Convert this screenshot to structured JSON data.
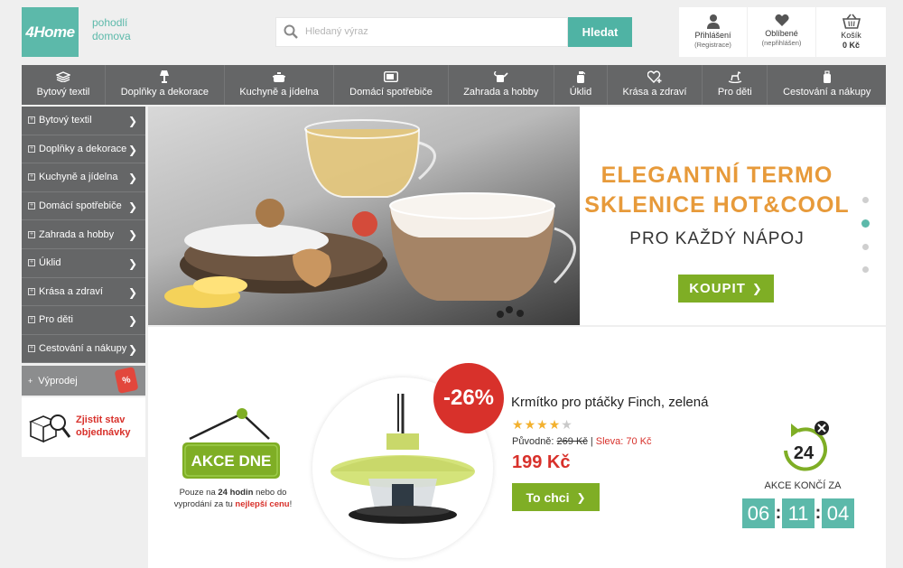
{
  "header": {
    "logo": "4Home",
    "tagline_line1": "pohodlí",
    "tagline_line2": "domova",
    "search_placeholder": "Hledaný výraz",
    "search_button": "Hledat",
    "login_label": "Přihlášení",
    "register_label": "(Registrace)",
    "favorites_label": "Oblíbené",
    "favorites_status": "(nepřihlášen)",
    "cart_label": "Košík",
    "cart_total": "0 Kč"
  },
  "topnav": [
    {
      "label": "Bytový textil",
      "icon": "textile-icon"
    },
    {
      "label": "Doplňky a dekorace",
      "icon": "lamp-icon"
    },
    {
      "label": "Kuchyně a jídelna",
      "icon": "pot-icon"
    },
    {
      "label": "Domácí spotřebiče",
      "icon": "appliance-icon"
    },
    {
      "label": "Zahrada a hobby",
      "icon": "watering-can-icon"
    },
    {
      "label": "Úklid",
      "icon": "spray-bottle-icon"
    },
    {
      "label": "Krása a zdraví",
      "icon": "heart-plus-icon"
    },
    {
      "label": "Pro děti",
      "icon": "rocking-horse-icon"
    },
    {
      "label": "Cestování a nákupy",
      "icon": "suitcase-icon"
    }
  ],
  "sidebar": {
    "items": [
      "Bytový textil",
      "Doplňky a dekorace",
      "Kuchyně a jídelna",
      "Domácí spotřebiče",
      "Zahrada a hobby",
      "Úklid",
      "Krása a zdraví",
      "Pro děti",
      "Cestování a nákupy"
    ],
    "sale_label": "Výprodej",
    "sale_tag": "%",
    "order_status_line1": "Zjistit stav",
    "order_status_line2": "objednávky"
  },
  "banner": {
    "headline1": "ELEGANTNÍ TERMO",
    "headline2": "SKLENICE HOT&COOL",
    "subline": "PRO KAŽDÝ NÁPOJ",
    "button": "KOUPIT",
    "slide_count": 4,
    "active_slide": 2
  },
  "deal": {
    "sign_label": "AKCE DNE",
    "note_pre": "Pouze na ",
    "note_bold": "24 hodin",
    "note_mid": " nebo do vyprodání za tu ",
    "note_red": "nejlepší cenu",
    "note_end": "!",
    "discount": "-26%",
    "product_title": "Krmítko pro ptáčky Finch, zelená",
    "rating": 4,
    "rating_max": 5,
    "original_label": "Původně:",
    "original_price": "269 Kč",
    "separator": "|",
    "discount_label": "Sleva: 70 Kč",
    "price": "199 Kč",
    "cta": "To chci",
    "timer_number": "24",
    "timer_label": "AKCE KONČÍ ZA",
    "hours": "06",
    "minutes": "11",
    "seconds": "04"
  },
  "colors": {
    "brand": "#5cb9aa",
    "nav": "#656667",
    "accent_green": "#7fae25",
    "sale_red": "#d8312b",
    "headline_orange": "#e79a3a"
  }
}
